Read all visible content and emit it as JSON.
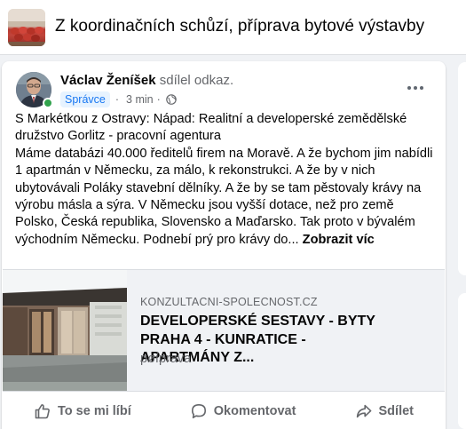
{
  "group": {
    "title": "Z koordinačních schůzí, příprava bytové výstavby",
    "thumbnail_icon": "group-cover-photo"
  },
  "post": {
    "author": "Václav Ženíšek",
    "action": "sdílel odkaz.",
    "role_badge": "Správce",
    "time": "3 min",
    "separator": "·",
    "privacy_icon": "globe-icon",
    "more_icon": "more-options-icon",
    "text_paragraphs": [
      "S Markétkou z Ostravy: Nápad: Realitní a developerské zemědělské družstvo Gorlitz - pracovní agentura",
      "Máme databázi 40.000 ředitelů firem na Moravě. A že bychom jim nabídli 1 apartmán v Německu, za málo, k rekonstrukci. A že by v nich ubytovávali Poláky stavební dělníky. A že by se tam pěstovaly  krávy na výrobu másla a sýra. V Německu jsou vyšší dotace, než pro země Polsko, Česká republika, Slovensko a Maďarsko. Tak proto v bývalém východním Německu. Podnebí prý pro krávy do..."
    ],
    "see_more": "Zobrazit víc"
  },
  "link_preview": {
    "domain": "KONZULTACNI-SPOLECNOST.CZ",
    "title": "DEVELOPERSKÉ SESTAVY - BYTY PRAHA 4 - KUNRATICE - APARTMÁNY Z...",
    "description": "pøíprava"
  },
  "actions": {
    "like": "To se mi líbí",
    "comment": "Okomentovat",
    "share": "Sdílet"
  },
  "colors": {
    "accent": "#1877f2",
    "secondary_text": "#65676b",
    "background": "#f0f2f5",
    "online": "#31a24c"
  }
}
